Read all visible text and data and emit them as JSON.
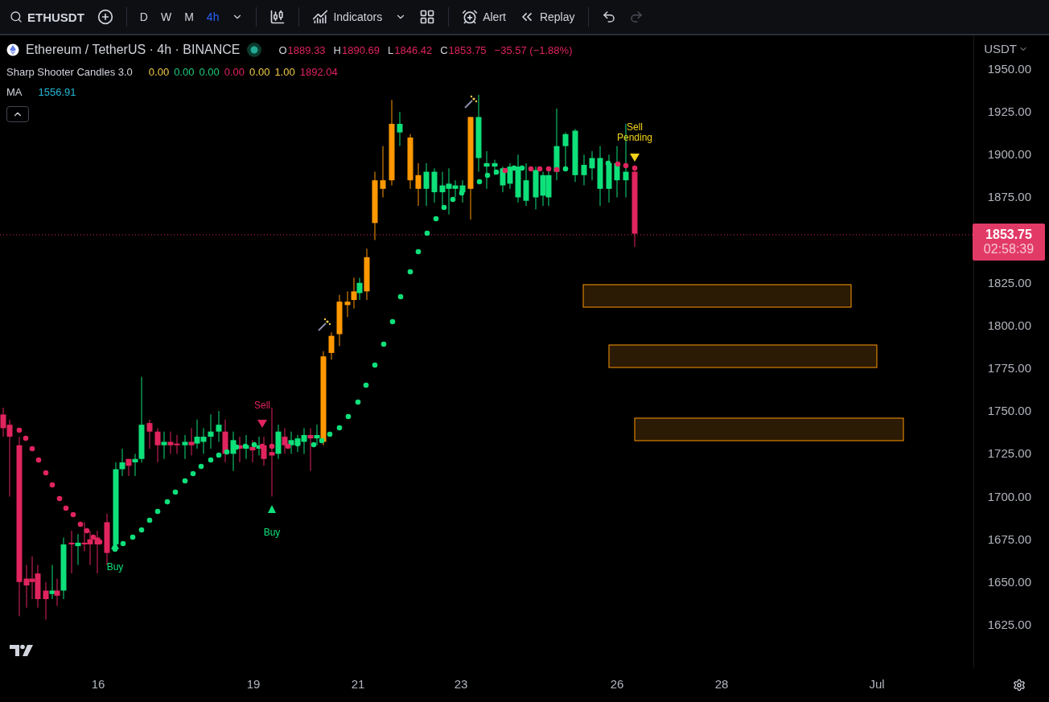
{
  "toolbar": {
    "symbol": "ETHUSDT",
    "intervals": [
      {
        "label": "D",
        "selected": false
      },
      {
        "label": "W",
        "selected": false
      },
      {
        "label": "M",
        "selected": false
      },
      {
        "label": "4h",
        "selected": true
      }
    ],
    "indicators_label": "Indicators",
    "alert_label": "Alert",
    "replay_label": "Replay",
    "redo_disabled": true
  },
  "legend": {
    "title": "Ethereum / TetherUS · 4h · BINANCE",
    "ohlc": [
      {
        "key": "O",
        "value": "1889.33"
      },
      {
        "key": "H",
        "value": "1890.69"
      },
      {
        "key": "L",
        "value": "1846.42"
      },
      {
        "key": "C",
        "value": "1853.75"
      }
    ],
    "change": "−35.57 (−1.88%)"
  },
  "indicators": [
    {
      "name": "Sharp Shooter Candles 3.0",
      "values": [
        {
          "text": "0.00",
          "color": "#f2c94c"
        },
        {
          "text": "0.00",
          "color": "#1ecb7b"
        },
        {
          "text": "0.00",
          "color": "#1ecb7b"
        },
        {
          "text": "0.00",
          "color": "#e0245e"
        },
        {
          "text": "0.00",
          "color": "#f2c94c"
        },
        {
          "text": "1.00",
          "color": "#f2c94c"
        },
        {
          "text": "1892.04",
          "color": "#e0245e"
        }
      ]
    },
    {
      "name": "MA",
      "values": [
        {
          "text": "1556.91",
          "color": "#22b7d6"
        }
      ]
    }
  ],
  "price_axis": {
    "currency": "USDT",
    "ticks": [
      "1950.00",
      "1925.00",
      "1900.00",
      "1875.00",
      "1825.00",
      "1800.00",
      "1775.00",
      "1750.00",
      "1725.00",
      "1700.00",
      "1675.00",
      "1650.00",
      "1625.00"
    ]
  },
  "last_price": {
    "price": "1853.75",
    "countdown": "02:58:39"
  },
  "time_axis": [
    "16",
    "19",
    "21",
    "23",
    "26",
    "28",
    "Jul"
  ],
  "signals": [
    {
      "kind": "sell",
      "text": "Sell"
    },
    {
      "kind": "buy",
      "text": "Buy"
    },
    {
      "kind": "buy",
      "text": "Buy"
    },
    {
      "kind": "pending",
      "text": "Sell Pending"
    }
  ]
}
